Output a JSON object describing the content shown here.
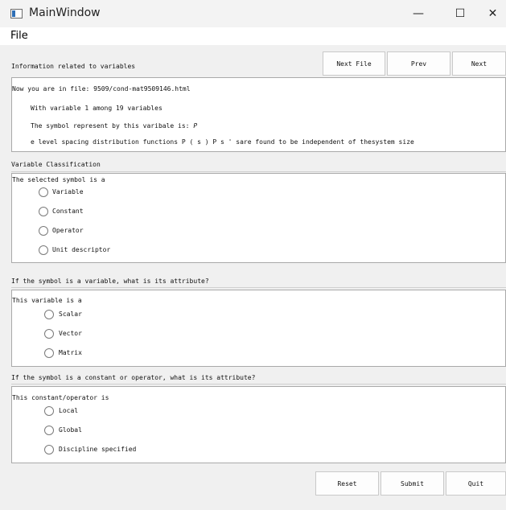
{
  "window": {
    "title": "MainWindow",
    "minimize": "—",
    "maximize": "☐",
    "close": "✕"
  },
  "menu": {
    "file": "File"
  },
  "header": {
    "label": "Information related to variables",
    "next_file": "Next File",
    "prev": "Prev",
    "next": "Next"
  },
  "info": {
    "file_line": "Now you are in file: 9509/cond-mat9509146.html",
    "variable_line": "With variable 1 among 19 variables",
    "symbol_line": "The symbol represent by this varibale is:",
    "symbol": "P",
    "context": "e level spacing distribution functions P  ( s ) P s ' sare found to be independent of thesystem size"
  },
  "classification": {
    "title": "Variable Classification",
    "prompt": "The selected symbol is a",
    "options": [
      "Variable",
      "Constant",
      "Operator",
      "Unit descriptor"
    ]
  },
  "variable_attr": {
    "title": "If the symbol is a variable, what is its attribute?",
    "prompt": "This variable is a",
    "options": [
      "Scalar",
      "Vector",
      "Matrix"
    ]
  },
  "constant_attr": {
    "title": "If the symbol is a constant or operator, what is its attribute?",
    "prompt": "This constant/operator is",
    "options": [
      "Local",
      "Global",
      "Discipline specified"
    ]
  },
  "footer": {
    "reset": "Reset",
    "submit": "Submit",
    "quit": "Quit"
  }
}
